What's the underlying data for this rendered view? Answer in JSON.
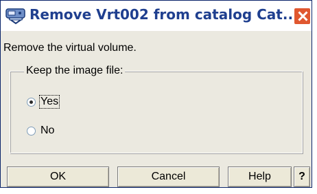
{
  "window": {
    "title": "Remove Vrt002 from catalog Cat...",
    "icons": {
      "app": "catalog-disk-icon",
      "close": "close-x-icon"
    }
  },
  "dialog": {
    "message": "Remove the virtual volume.",
    "group_label": "Keep the image file:",
    "options": [
      {
        "label": "Yes",
        "selected": true
      },
      {
        "label": "No",
        "selected": false
      }
    ]
  },
  "buttons": {
    "ok": "OK",
    "cancel": "Cancel",
    "help": "Help",
    "whats_this": "?"
  },
  "colors": {
    "title_text": "#1f3f8f",
    "close_button": "#e0572f",
    "dialog_bg": "#ebe9e0"
  }
}
